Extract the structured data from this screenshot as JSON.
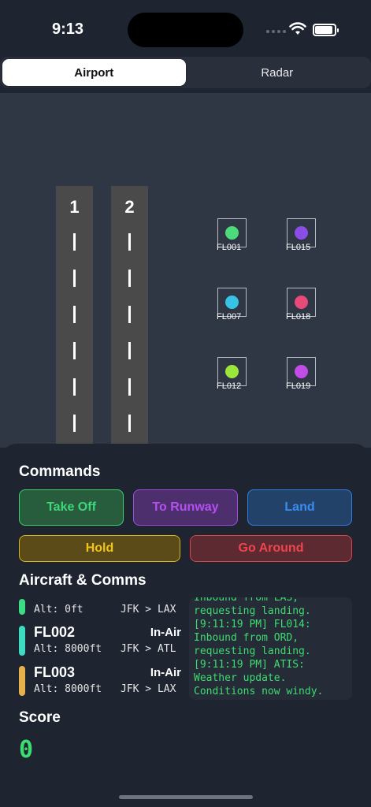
{
  "status": {
    "time": "9:13"
  },
  "tabs": [
    {
      "label": "Airport",
      "active": true
    },
    {
      "label": "Radar",
      "active": false
    }
  ],
  "runways": [
    {
      "label": "1"
    },
    {
      "label": "2"
    }
  ],
  "planes": [
    {
      "id": "FL001",
      "color": "#4ddb7a"
    },
    {
      "id": "FL015",
      "color": "#8a4de6"
    },
    {
      "id": "FL007",
      "color": "#36c3e6"
    },
    {
      "id": "FL018",
      "color": "#e64a78"
    },
    {
      "id": "FL012",
      "color": "#9be63a"
    },
    {
      "id": "FL019",
      "color": "#c14de6"
    }
  ],
  "commands": {
    "title": "Commands",
    "take_off": "Take Off",
    "to_runway": "To Runway",
    "land": "Land",
    "hold": "Hold",
    "go_around": "Go Around"
  },
  "aircraft_section": {
    "title": "Aircraft & Comms"
  },
  "aircraft": [
    {
      "id": "",
      "status": "",
      "alt": "Alt: 0ft",
      "route": "JFK > LAX",
      "color": "#3ddc84"
    },
    {
      "id": "FL002",
      "status": "In-Air",
      "alt": "Alt: 8000ft",
      "route": "JFK > ATL",
      "color": "#3ddcc0"
    },
    {
      "id": "FL003",
      "status": "In-Air",
      "alt": "Alt: 8000ft",
      "route": "JFK > LAX",
      "color": "#e6b04d"
    }
  ],
  "comms_log": "Inbound from LAS,\nrequesting landing.\n[9:11:19 PM] FL014:\nInbound from ORD,\nrequesting landing.\n[9:11:19 PM] ATIS:\nWeather update.\nConditions now windy.",
  "score": {
    "title": "Score",
    "value": "0"
  }
}
